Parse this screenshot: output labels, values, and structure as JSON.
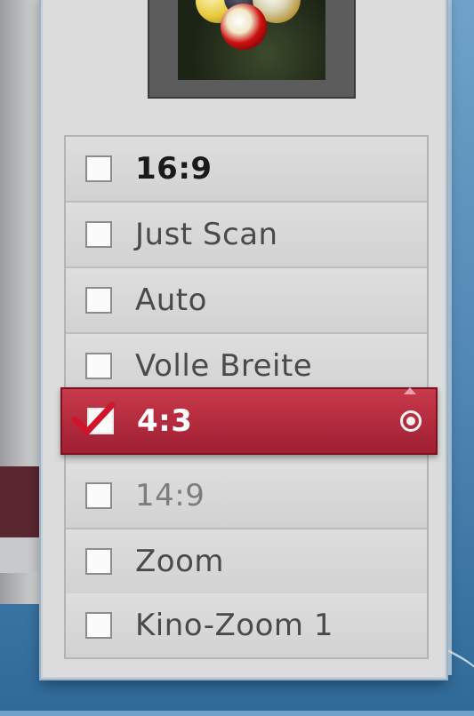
{
  "aspect_menu": {
    "items": [
      {
        "label": "16:9",
        "checked": false,
        "style": "first"
      },
      {
        "label": "Just Scan",
        "checked": false,
        "style": "normal"
      },
      {
        "label": "Auto",
        "checked": false,
        "style": "normal"
      },
      {
        "label": "Volle Breite",
        "checked": false,
        "style": "normal"
      },
      {
        "label": "4:3",
        "checked": true,
        "style": "selected"
      },
      {
        "label": "14:9",
        "checked": false,
        "style": "dim"
      },
      {
        "label": "Zoom",
        "checked": false,
        "style": "normal"
      },
      {
        "label": "Kino-Zoom 1",
        "checked": false,
        "style": "normal"
      }
    ],
    "selected_index": 4
  },
  "colors": {
    "highlight": "#b02a3e",
    "check_mark": "#d0142c",
    "panel": "#dcdcdc"
  },
  "icons": {
    "selected_indicator": "radio-dot-icon",
    "scroll_hint": "up-arrow-icon",
    "check": "checkmark-icon"
  }
}
